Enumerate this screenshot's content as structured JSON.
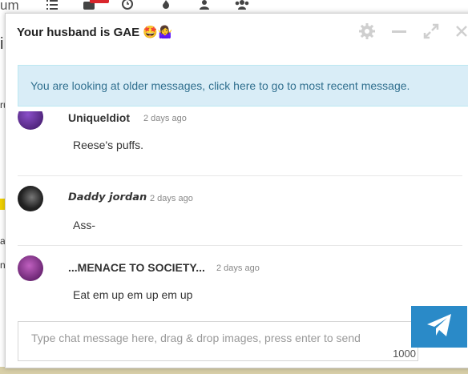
{
  "background": {
    "forum_text": "um",
    "nav_icons": [
      "list-icon",
      "notifications-icon",
      "clock-icon",
      "fire-icon",
      "user-icon",
      "users-icon"
    ],
    "left_glyphs": [
      "i",
      "ru",
      "u",
      "a",
      "n"
    ]
  },
  "chat": {
    "title": "Your husband is GAE 🤩🤷‍♀️",
    "header_icons": [
      "gear-icon",
      "minimize-icon",
      "maximize-icon",
      "close-icon"
    ],
    "notice": "You are looking at older messages, click here to go to most recent message.",
    "messages": [
      {
        "author": "Uniqueldiot",
        "time": "2 days ago",
        "text": "Reese's puffs.",
        "avatar_color": "#5b2a86"
      },
      {
        "author": "𝘿𝙖𝙙𝙙𝙮 𝙟𝙤𝙧𝙙𝙖𝙣",
        "time": "2 days ago",
        "text": "Ass-",
        "avatar_color": "#222222"
      },
      {
        "author": "...MENACE TO SOCIETY...",
        "time": "2 days ago",
        "text": "Eat em up em up em up",
        "avatar_color": "#6a1b7a"
      }
    ],
    "composer": {
      "placeholder": "Type chat message here, drag & drop images, press enter to send",
      "char_count": "1000"
    },
    "send_icon": "paper-plane-icon",
    "accent": "#2a8ac8"
  }
}
